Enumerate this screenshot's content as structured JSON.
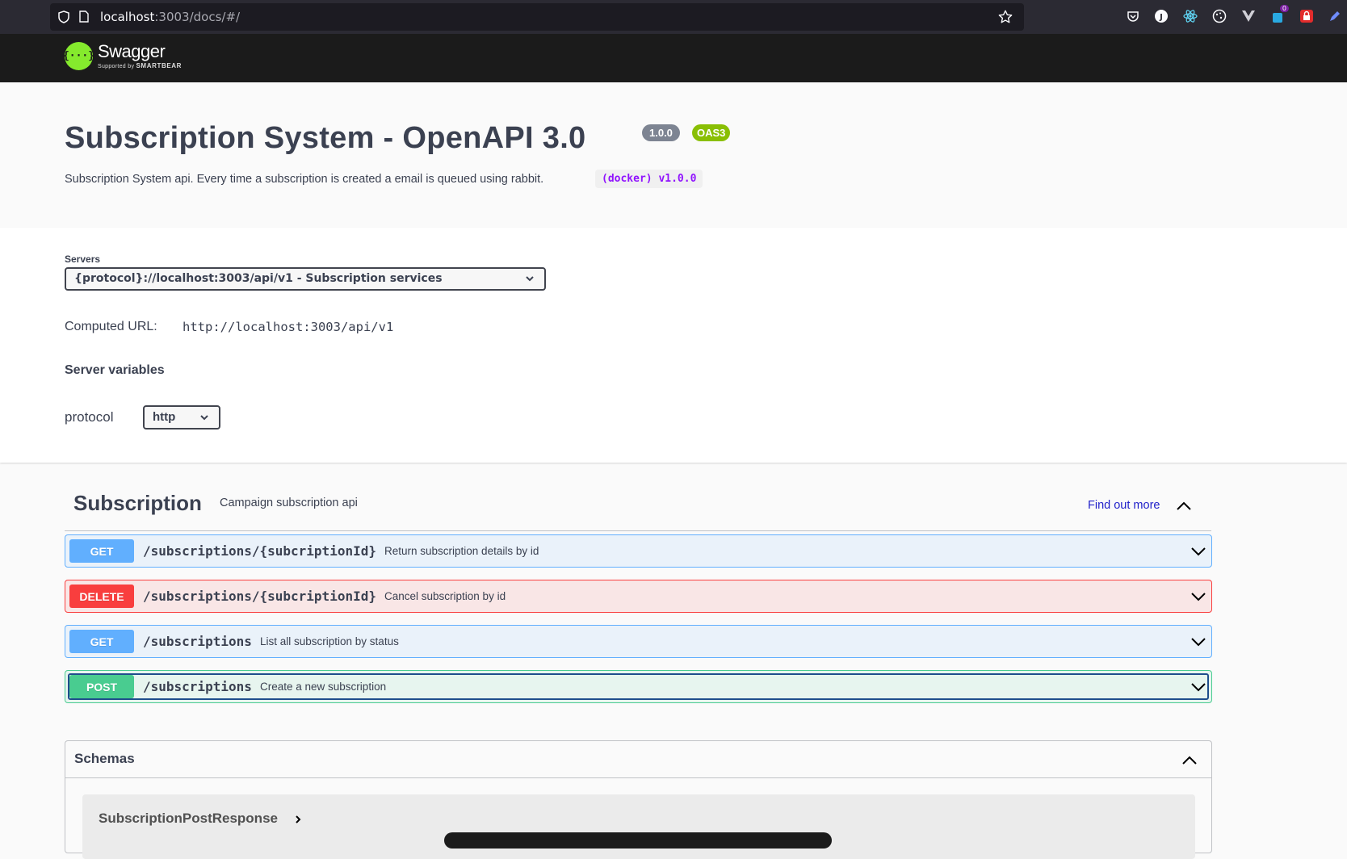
{
  "browser": {
    "url_host": "localhost",
    "url_rest": ":3003/docs/#/",
    "extensions": [
      "pocket-icon",
      "j-extension-icon",
      "react-devtools-icon",
      "cookie-icon",
      "vue-devtools-icon",
      "notification-extension-icon",
      "lock-extension-icon",
      "pen-icon"
    ],
    "notification_count": "0"
  },
  "topbar": {
    "logo_mark": "{···}",
    "logo_name": "Swagger",
    "logo_sub_prefix": "Supported by",
    "logo_sub_brand": "SMARTBEAR"
  },
  "info": {
    "title": "Subscription System - OpenAPI 3.0",
    "version": "1.0.0",
    "oas": "OAS3",
    "description": "Subscription System api. Every time a subscription is created a email is queued using rabbit.",
    "code": "(docker) v1.0.0"
  },
  "servers": {
    "label": "Servers",
    "selected": "{protocol}://localhost:3003/api/v1 - Subscription services",
    "computed_label": "Computed URL:",
    "computed_url": "http://localhost:3003/api/v1",
    "vars_title": "Server variables",
    "var_name": "protocol",
    "var_value": "http"
  },
  "tag": {
    "name": "Subscription",
    "description": "Campaign subscription api",
    "link": "Find out more"
  },
  "operations": [
    {
      "method": "GET",
      "path": "/subscriptions/{subcriptionId}",
      "summary": "Return subscription details by id"
    },
    {
      "method": "DELETE",
      "path": "/subscriptions/{subcriptionId}",
      "summary": "Cancel subscription by id"
    },
    {
      "method": "GET",
      "path": "/subscriptions",
      "summary": "List all subscription by status"
    },
    {
      "method": "POST",
      "path": "/subscriptions",
      "summary": "Create a new subscription"
    }
  ],
  "schemas": {
    "title": "Schemas",
    "models": [
      "SubscriptionPostResponse"
    ]
  },
  "colors": {
    "get": "#61affe",
    "delete": "#f93e3e",
    "post": "#49cc90",
    "swagger_green": "#85ea2d",
    "oas_badge": "#89bf04"
  }
}
